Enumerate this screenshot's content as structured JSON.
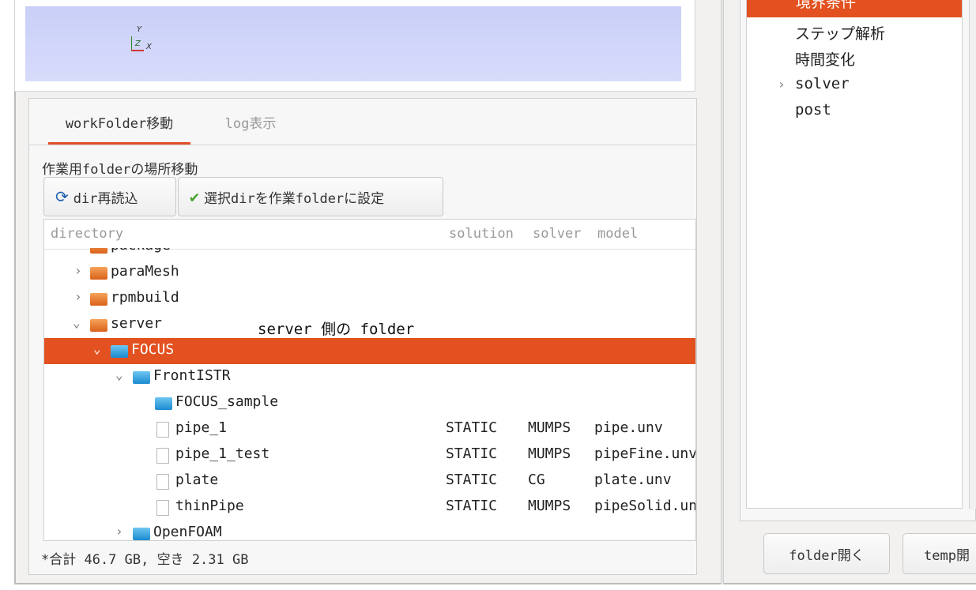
{
  "axis": {
    "y": "Y",
    "z": "Z",
    "x": "X"
  },
  "tabs": [
    {
      "label": "workFolder移動",
      "active": true
    },
    {
      "label": "log表示",
      "active": false
    }
  ],
  "section_label": "作業用folderの場所移動",
  "buttons": {
    "reload": "dir再読込",
    "set_workfolder": "選択dirを作業folderに設定"
  },
  "tree_headers": {
    "directory": "directory",
    "solution": "solution",
    "solver": "solver",
    "model": "model"
  },
  "rows": [
    {
      "name": "package",
      "type": "folder-orange",
      "arrow": "›",
      "depth": 1
    },
    {
      "name": "paraMesh",
      "type": "folder-orange",
      "arrow": "›",
      "depth": 1
    },
    {
      "name": "rpmbuild",
      "type": "folder-orange",
      "arrow": "›",
      "depth": 1
    },
    {
      "name": "server",
      "type": "folder-orange",
      "arrow": "⌄",
      "depth": 1
    },
    {
      "name": "FOCUS",
      "type": "folder-blue",
      "arrow": "⌄",
      "depth": 2,
      "selected": true
    },
    {
      "name": "FrontISTR",
      "type": "folder-blue",
      "arrow": "⌄",
      "depth": 3
    },
    {
      "name": "FOCUS_sample",
      "type": "folder-blue",
      "arrow": "",
      "depth": 4
    },
    {
      "name": "pipe_1",
      "type": "file",
      "depth": 4,
      "solution": "STATIC",
      "solver": "MUMPS",
      "model": "pipe.unv"
    },
    {
      "name": "pipe_1_test",
      "type": "file",
      "depth": 4,
      "solution": "STATIC",
      "solver": "MUMPS",
      "model": "pipeFine.unv"
    },
    {
      "name": "plate",
      "type": "file",
      "depth": 4,
      "solution": "STATIC",
      "solver": "CG",
      "model": "plate.unv"
    },
    {
      "name": "thinPipe",
      "type": "file",
      "depth": 4,
      "solution": "STATIC",
      "solver": "MUMPS",
      "model": "pipeSolid.unv"
    },
    {
      "name": "OpenFOAM",
      "type": "folder-blue",
      "arrow": "›",
      "depth": 3
    }
  ],
  "annotation": "server 側の folder",
  "status": "*合計 46.7 GB, 空き 2.31 GB",
  "right_tree": {
    "selected_item": "境界条件",
    "items": [
      {
        "label": "ステップ解析",
        "arrow": ""
      },
      {
        "label": "時間変化",
        "arrow": ""
      },
      {
        "label": "solver",
        "arrow": "›"
      },
      {
        "label": "post",
        "arrow": ""
      }
    ]
  },
  "right_buttons": {
    "open_folder": "folder開く",
    "open_temp": "temp開"
  },
  "colors": {
    "selection": "#e2511f",
    "viewer_bg": "#c9cff8"
  }
}
